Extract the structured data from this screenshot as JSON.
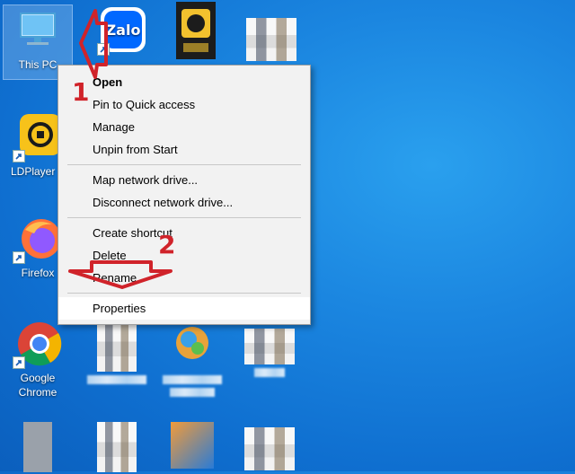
{
  "desktop": {
    "icons": [
      {
        "label": "This PC"
      },
      {
        "label": "Zalo"
      },
      {
        "label": "LDPlayer"
      },
      {
        "label": "Firefox"
      },
      {
        "label": "Google Chrome"
      }
    ]
  },
  "context_menu": {
    "items": [
      "Open",
      "Pin to Quick access",
      "Manage",
      "Unpin from Start",
      "Map network drive...",
      "Disconnect network drive...",
      "Create shortcut",
      "Delete",
      "Rename",
      "Properties"
    ]
  },
  "annotations": {
    "step1": "1",
    "step2": "2"
  },
  "colors": {
    "desktop": "#1b86e0",
    "annotation": "#d0232a",
    "zalo": "#0068ff",
    "ldplayer": "#f7c21a"
  }
}
